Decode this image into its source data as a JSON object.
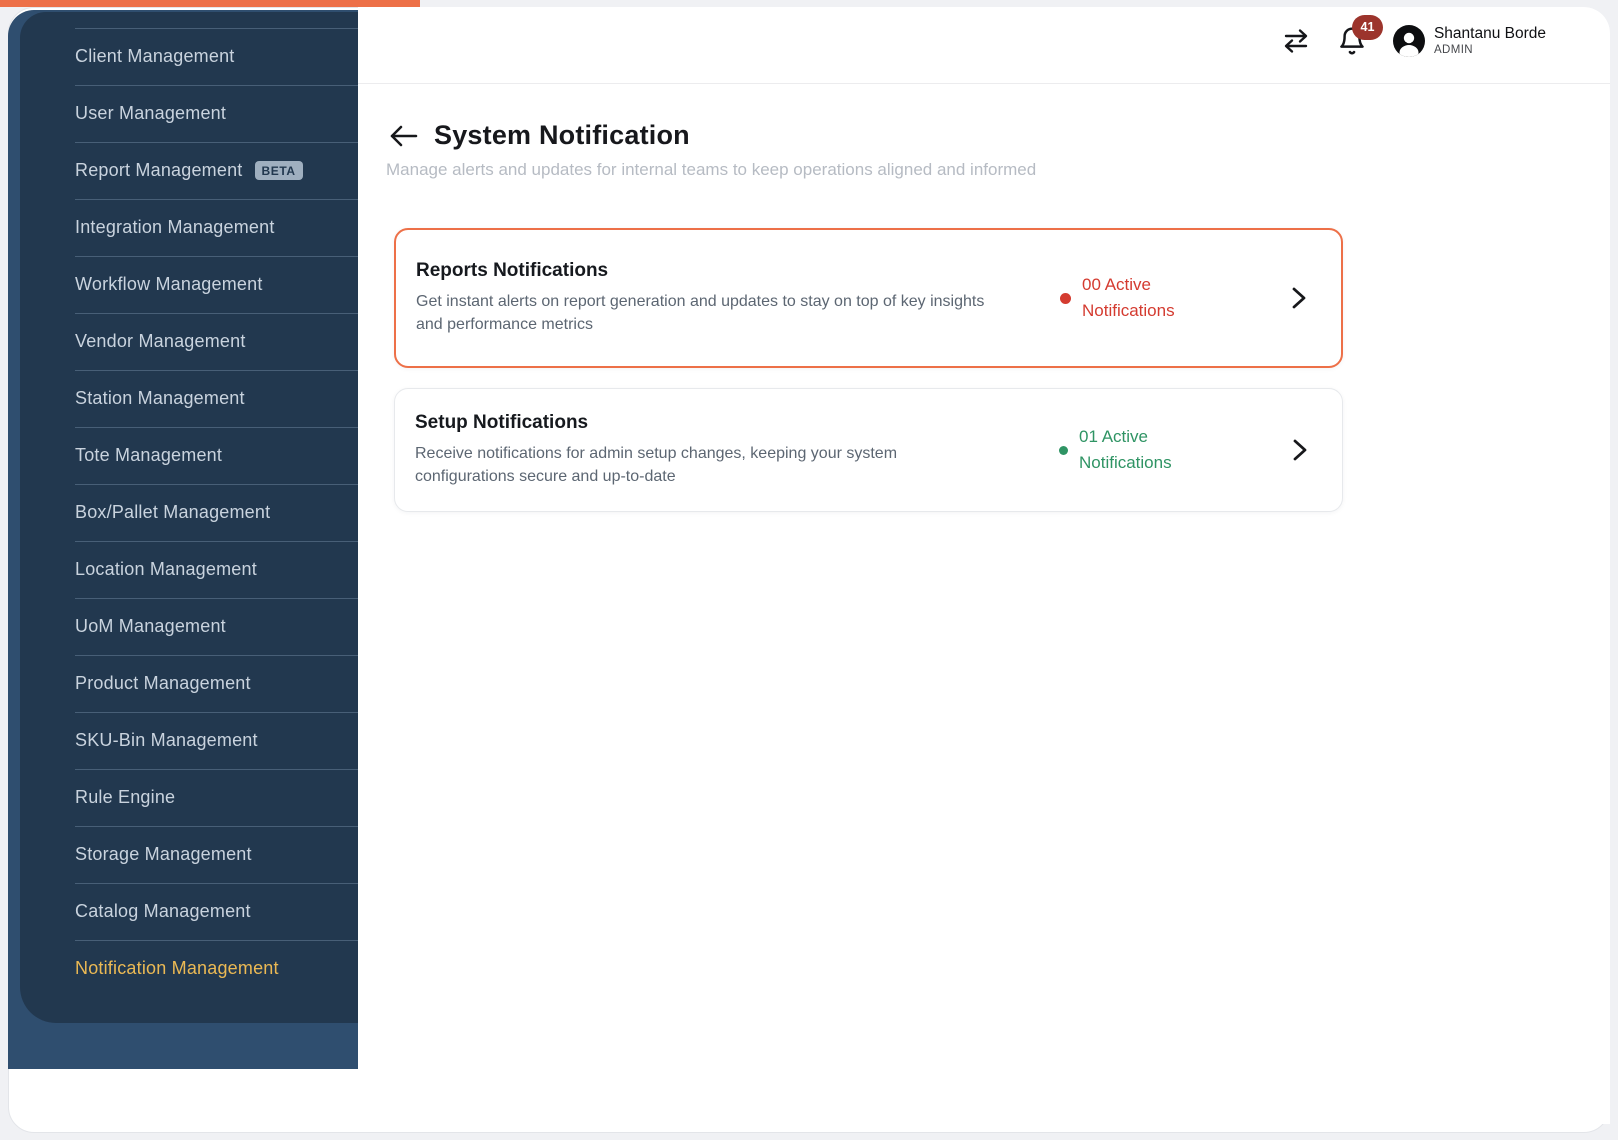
{
  "colors": {
    "accent": "#ED7048",
    "red": "#D43B30",
    "green": "#2F9464",
    "gold": "#EBB954",
    "sidebar_panel": "#22384F",
    "sidebar_background": "#2F4E6F",
    "notification_badge": "#9C342C"
  },
  "sidebar": {
    "items": [
      {
        "label": "Client Management"
      },
      {
        "label": "User Management"
      },
      {
        "label": "Report Management",
        "badge": "BETA"
      },
      {
        "label": "Integration Management"
      },
      {
        "label": "Workflow Management"
      },
      {
        "label": "Vendor Management"
      },
      {
        "label": "Station Management"
      },
      {
        "label": "Tote Management"
      },
      {
        "label": "Box/Pallet Management"
      },
      {
        "label": "Location Management"
      },
      {
        "label": "UoM Management"
      },
      {
        "label": "Product Management"
      },
      {
        "label": "SKU-Bin Management"
      },
      {
        "label": "Rule Engine"
      },
      {
        "label": "Storage Management"
      },
      {
        "label": "Catalog Management"
      },
      {
        "label": "Notification Management",
        "active": true
      }
    ]
  },
  "header": {
    "icons": [
      "swap-arrows-icon",
      "bell-icon",
      "avatar-icon"
    ],
    "notification_count": "41",
    "user": {
      "name": "Shantanu Borde",
      "role": "ADMIN"
    }
  },
  "page": {
    "title": "System Notification",
    "subtitle": "Manage alerts and updates for internal teams to keep operations aligned and informed"
  },
  "cards": [
    {
      "title": "Reports Notifications",
      "description": "Get instant alerts on report generation and updates to stay on top of key insights\nand performance metrics",
      "status": "00 Active\nNotifications",
      "status_color": "#D43B30",
      "highlighted": true
    },
    {
      "title": "Setup Notifications",
      "description": "Receive notifications for admin setup changes, keeping your system\nconfigurations secure and up-to-date",
      "status": "01 Active\nNotifications",
      "status_color": "#2F9464",
      "highlighted": false
    }
  ]
}
